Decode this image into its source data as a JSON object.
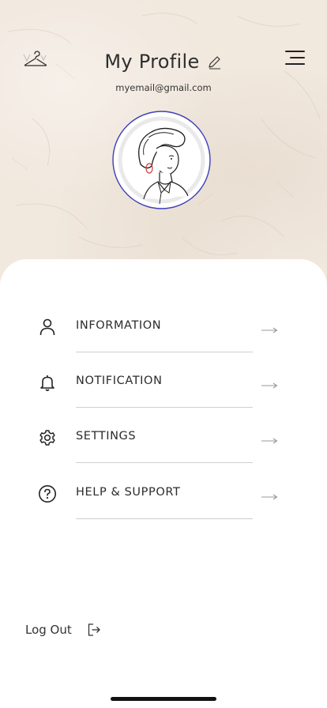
{
  "header": {
    "title": "My Profile",
    "email": "myemail@gmail.com",
    "left_icon": "hanger-icon",
    "right_icon": "menu-icon",
    "edit_icon": "pencil-icon"
  },
  "menu": {
    "items": [
      {
        "label": "INFORMATION",
        "icon": "user-icon"
      },
      {
        "label": "NOTIFICATION",
        "icon": "bell-icon"
      },
      {
        "label": "SETTINGS",
        "icon": "gear-icon"
      },
      {
        "label": "HELP & SUPPORT",
        "icon": "help-icon"
      }
    ]
  },
  "logout": {
    "label": "Log Out",
    "icon": "logout-icon"
  },
  "colors": {
    "background": "#f1e8de",
    "card": "#ffffff",
    "text": "#2b2b2b",
    "avatar_ring": "#3b3fb8",
    "divider": "#cfcfcf"
  }
}
